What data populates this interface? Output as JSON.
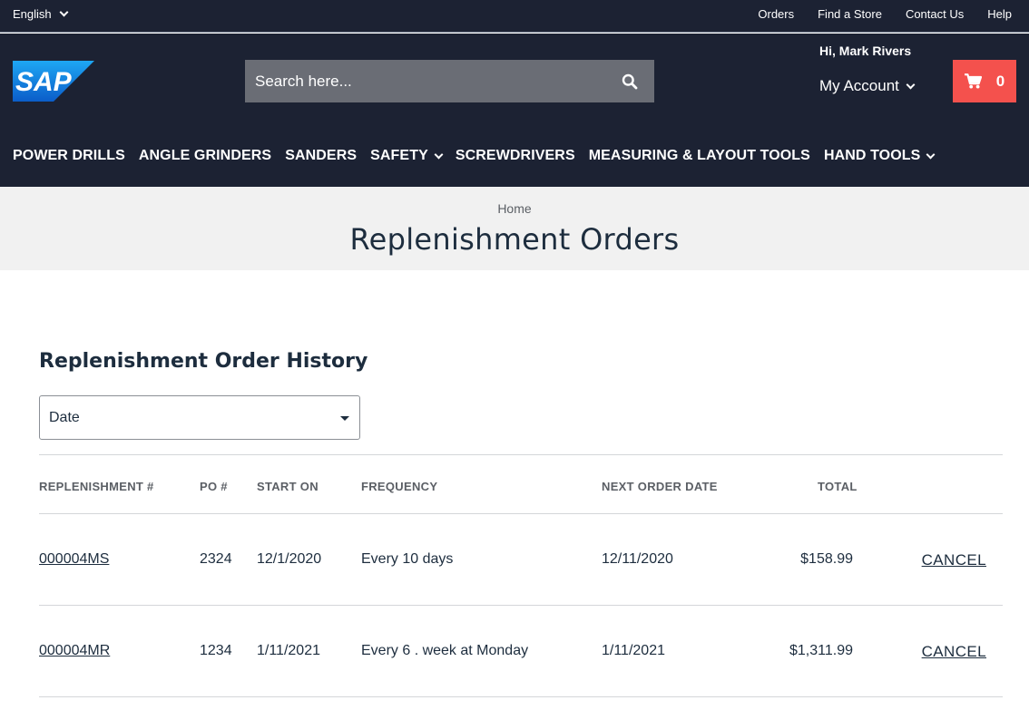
{
  "topbar": {
    "language": "English",
    "links": [
      "Orders",
      "Find a Store",
      "Contact Us",
      "Help"
    ]
  },
  "header": {
    "logo_text": "SAP",
    "search_placeholder": "Search here...",
    "greeting": "Hi, Mark Rivers",
    "account_label": "My Account",
    "cart_count": "0",
    "categories": [
      "POWER DRILLS",
      "ANGLE GRINDERS",
      "SANDERS",
      "SAFETY",
      "SCREWDRIVERS",
      "MEASURING & LAYOUT TOOLS",
      "HAND TOOLS"
    ]
  },
  "page": {
    "breadcrumb": "Home",
    "title": "Replenishment Orders"
  },
  "history": {
    "title": "Replenishment Order History",
    "sort_value": "Date",
    "columns": [
      "REPLENISHMENT #",
      "PO #",
      "START ON",
      "FREQUENCY",
      "NEXT ORDER DATE",
      "TOTAL"
    ],
    "rows": [
      {
        "id": "000004MS",
        "po": "2324",
        "start": "12/1/2020",
        "frequency": "Every 10 days",
        "next": "12/11/2020",
        "total": "$158.99",
        "action": "CANCEL"
      },
      {
        "id": "000004MR",
        "po": "1234",
        "start": "1/11/2021",
        "frequency": "Every 6 . week at Monday",
        "next": "1/11/2021",
        "total": "$1,311.99",
        "action": "CANCEL"
      }
    ]
  },
  "colors": {
    "header_bg": "#1c2233",
    "cart_bg": "#f4514d",
    "search_bg": "#6a6d75",
    "logo_blue": "#1b7ce0"
  }
}
